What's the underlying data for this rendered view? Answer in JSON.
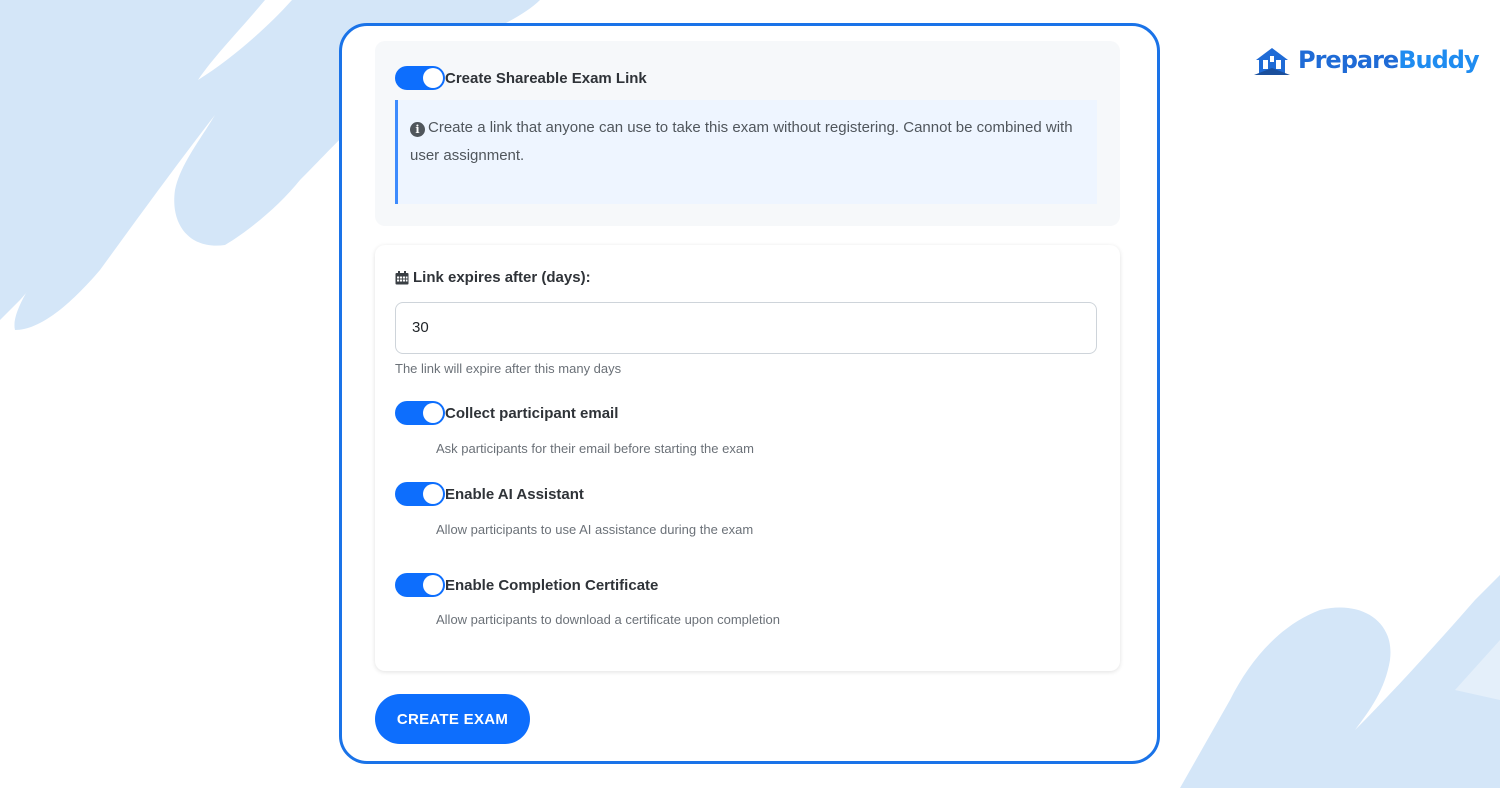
{
  "brand": {
    "name_part1": "Prepare",
    "name_part2": "Buddy"
  },
  "share_link": {
    "toggle_label": "Create Shareable Exam Link",
    "enabled": true,
    "info_text": "Create a link that anyone can use to take this exam without registering. Cannot be combined with user assignment."
  },
  "expiry": {
    "label": "Link expires after (days):",
    "value": "30",
    "help": "The link will expire after this many days"
  },
  "options": [
    {
      "label": "Collect participant email",
      "description": "Ask participants for their email before starting the exam",
      "enabled": true
    },
    {
      "label": "Enable AI Assistant",
      "description": "Allow participants to use AI assistance during the exam",
      "enabled": true
    },
    {
      "label": "Enable Completion Certificate",
      "description": "Allow participants to download a certificate upon completion",
      "enabled": true
    }
  ],
  "actions": {
    "create_label": "CREATE EXAM"
  },
  "colors": {
    "accent": "#0d6efd",
    "card_border": "#1a73e8",
    "background_stroke": "#cfe3f7"
  },
  "icons": [
    "info-icon",
    "calendar-icon",
    "logo-icon"
  ]
}
